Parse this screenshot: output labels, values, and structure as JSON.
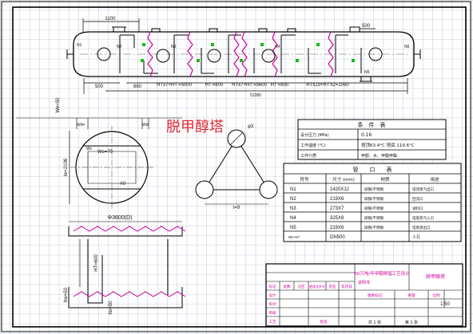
{
  "title_overlay": "脱甲醇塔",
  "vessel_elevation": {
    "dims_top_left": "1100",
    "dims_top_right": "500",
    "dim_left_end": "500",
    "dim_660": "660",
    "seg_label_1": "HTx7+HT'=5000",
    "seg_label_2": "HT'=800",
    "seg_label_3": "HTx7+HT'=5600",
    "seg_label_4": "HT'=800",
    "seg_label_5": "HTx15+HT'x2=1060",
    "dim_total": "52280",
    "nozzle_n1": "N1",
    "nozzle_n2": "N2",
    "nozzle_n3": "N3",
    "nozzle_n4": "N4",
    "nozzle_n5": "N5",
    "nozzle_n6": "N6"
  },
  "plan_view": {
    "we_label": "We=50",
    "wd_label": "Wd=",
    "wd_label2": "Wd",
    "ws_label": "Ws=70",
    "wc_label": "Wc",
    "area_label": "A0",
    "lw_label": "lw=2106"
  },
  "triangle": {
    "angle_label": "φ3",
    "pitch_label": "t=9"
  },
  "section_view": {
    "diameter_label": "Φ3600(D)",
    "ht_label": "HT=600",
    "hw_label": "hw=50",
    "ho_label": "ho=50"
  },
  "specs_table": {
    "header": "条　件　表",
    "rows": [
      {
        "name": "设计压力 (MPa)",
        "value": "0.16"
      },
      {
        "name": "工作温度 (°C)",
        "value": "塔顶63.4°C  塔底 119.6°C"
      },
      {
        "name": "工作介质",
        "value": "甲醇、水、甲酸甲酯"
      }
    ]
  },
  "nozzle_table": {
    "header": "管　　口　　表",
    "columns": [
      "符号",
      "尺寸 (mm)",
      "材质",
      "用途"
    ],
    "rows": [
      {
        "sym": "N1",
        "size": "1420X12",
        "mat": "碳钢/不锈钢",
        "use": "塔顶蒸汽出口"
      },
      {
        "sym": "N2",
        "size": "219X6",
        "mat": "碳钢/不锈钢",
        "use": "回流口"
      },
      {
        "sym": "N3",
        "size": "273X7",
        "mat": "碳钢/不锈钢",
        "use": "进料口"
      },
      {
        "sym": "N4",
        "size": "325X8",
        "mat": "碳钢/不锈钢",
        "use": "塔底蒸汽入口"
      },
      {
        "sym": "N5",
        "size": "219X6",
        "mat": "碳钢/不锈钢",
        "use": "塔底液出口"
      },
      {
        "sym": "N6~N7",
        "size": "DN500",
        "mat": "",
        "use": "人孔"
      }
    ]
  },
  "title_block": {
    "project": "60万吨/年甲醇精馏工艺设计",
    "project_sub": "说明书",
    "drawing_name": "脱甲醇塔",
    "scale_header_1": "图纸标记",
    "scale_header_2": "重量",
    "scale_header_3": "比例",
    "scale": "1:50",
    "sheets_total": "共 1 张",
    "sheet_no": "第 1 张",
    "rev_cols": [
      "标记",
      "处数",
      "分区",
      "更改文件号",
      "签名",
      "年月日"
    ],
    "role_1": "设计",
    "role_2": "校对",
    "role_3": "审核",
    "role_4": "工艺",
    "role_5": "批准"
  }
}
